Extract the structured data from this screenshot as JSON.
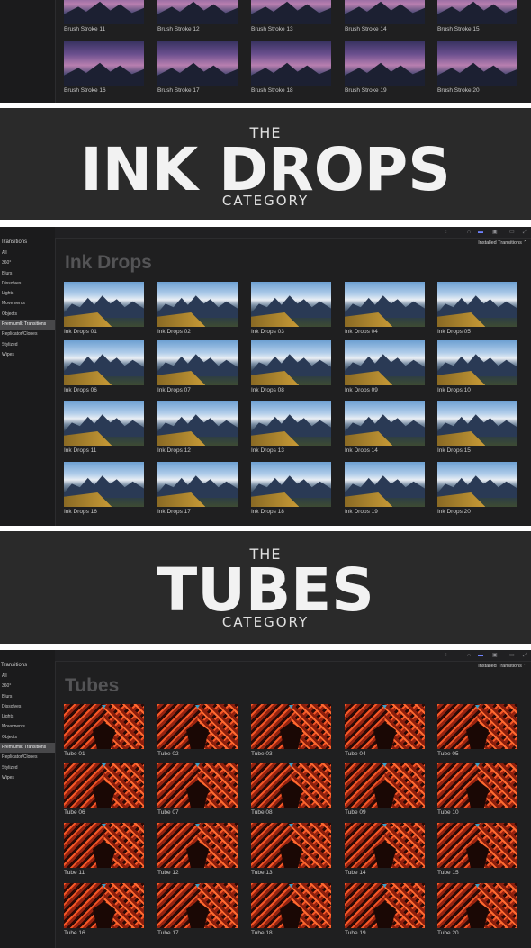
{
  "top_partial": {
    "items": [
      "Brush Stroke 11",
      "Brush Stroke 12",
      "Brush Stroke 13",
      "Brush Stroke 14",
      "Brush Stroke 15",
      "Brush Stroke 16",
      "Brush Stroke 17",
      "Brush Stroke 18",
      "Brush Stroke 19",
      "Brush Stroke 20"
    ]
  },
  "banner_ink": {
    "the": "THE",
    "main": "INK DROPS",
    "sub": "CATEGORY"
  },
  "banner_tubes": {
    "the": "THE",
    "main": "TUBES",
    "sub": "CATEGORY"
  },
  "browser_ink": {
    "sidebar_title": "Transitions",
    "sidebar": [
      "All",
      "360°",
      "Blurs",
      "Dissolves",
      "Lights",
      "Movements",
      "Objects",
      "Premiumlk Transitions",
      "Replicator/Clones",
      "Stylized",
      "Wipes"
    ],
    "selected_index": 7,
    "filter": "Installed Transitions ⌃",
    "category": "Ink Drops",
    "items": [
      "Ink Drops 01",
      "Ink Drops 02",
      "Ink Drops 03",
      "Ink Drops 04",
      "Ink Drops 05",
      "Ink Drops 06",
      "Ink Drops 07",
      "Ink Drops 08",
      "Ink Drops 09",
      "Ink Drops 10",
      "Ink Drops 11",
      "Ink Drops 12",
      "Ink Drops 13",
      "Ink Drops 14",
      "Ink Drops 15",
      "Ink Drops 16",
      "Ink Drops 17",
      "Ink Drops 18",
      "Ink Drops 19",
      "Ink Drops 20"
    ]
  },
  "browser_tubes": {
    "sidebar_title": "Transitions",
    "sidebar": [
      "All",
      "360°",
      "Blurs",
      "Dissolves",
      "Lights",
      "Movements",
      "Objects",
      "Premiumlk Transitions",
      "Replicator/Clones",
      "Stylized",
      "Wipes"
    ],
    "selected_index": 7,
    "filter": "Installed Transitions ⌃",
    "category": "Tubes",
    "items": [
      "Tube 01",
      "Tube 02",
      "Tube 03",
      "Tube 04",
      "Tube 05",
      "Tube 06",
      "Tube 07",
      "Tube 08",
      "Tube 09",
      "Tube 10",
      "Tube 11",
      "Tube 12",
      "Tube 13",
      "Tube 14",
      "Tube 15",
      "Tube 16",
      "Tube 17",
      "Tube 18",
      "Tube 19",
      "Tube 20"
    ]
  },
  "toolbar_icons": [
    "waveform-icon",
    "headphones-icon",
    "video-icon",
    "filmstrip-icon",
    "clip-icon",
    "fullscreen-icon"
  ],
  "colors": {
    "panel_bg": "#1f1f20",
    "sidebar_selected": "#48484a",
    "banner_bg": "#2a2a2a",
    "category_title": "#545456"
  }
}
